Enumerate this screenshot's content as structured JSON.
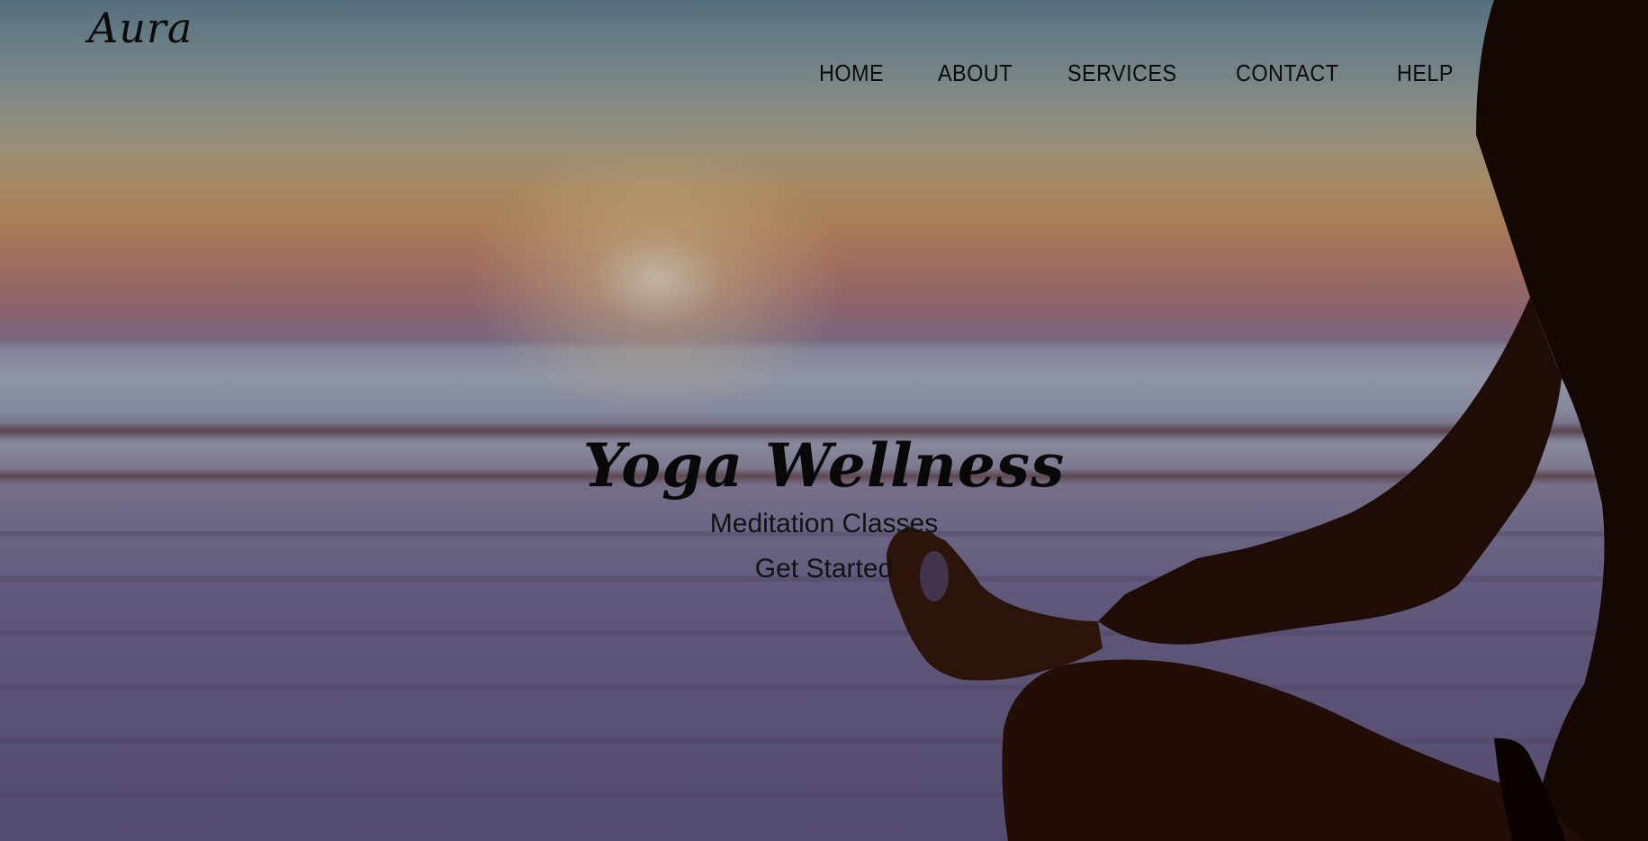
{
  "brand": {
    "logo_text": "Aura"
  },
  "nav": {
    "items": [
      {
        "label": "HOME"
      },
      {
        "label": "ABOUT"
      },
      {
        "label": "SERVICES"
      },
      {
        "label": "CONTACT"
      },
      {
        "label": "HELP"
      }
    ]
  },
  "hero": {
    "title": "Yoga Wellness",
    "subtitle": "Meditation Classes",
    "cta_label": "Get Started",
    "background_image": "sunset-beach-meditation-silhouette"
  },
  "colors": {
    "text": "#0b0b0b",
    "overlay": "rgba(0,0,0,0.22)"
  }
}
